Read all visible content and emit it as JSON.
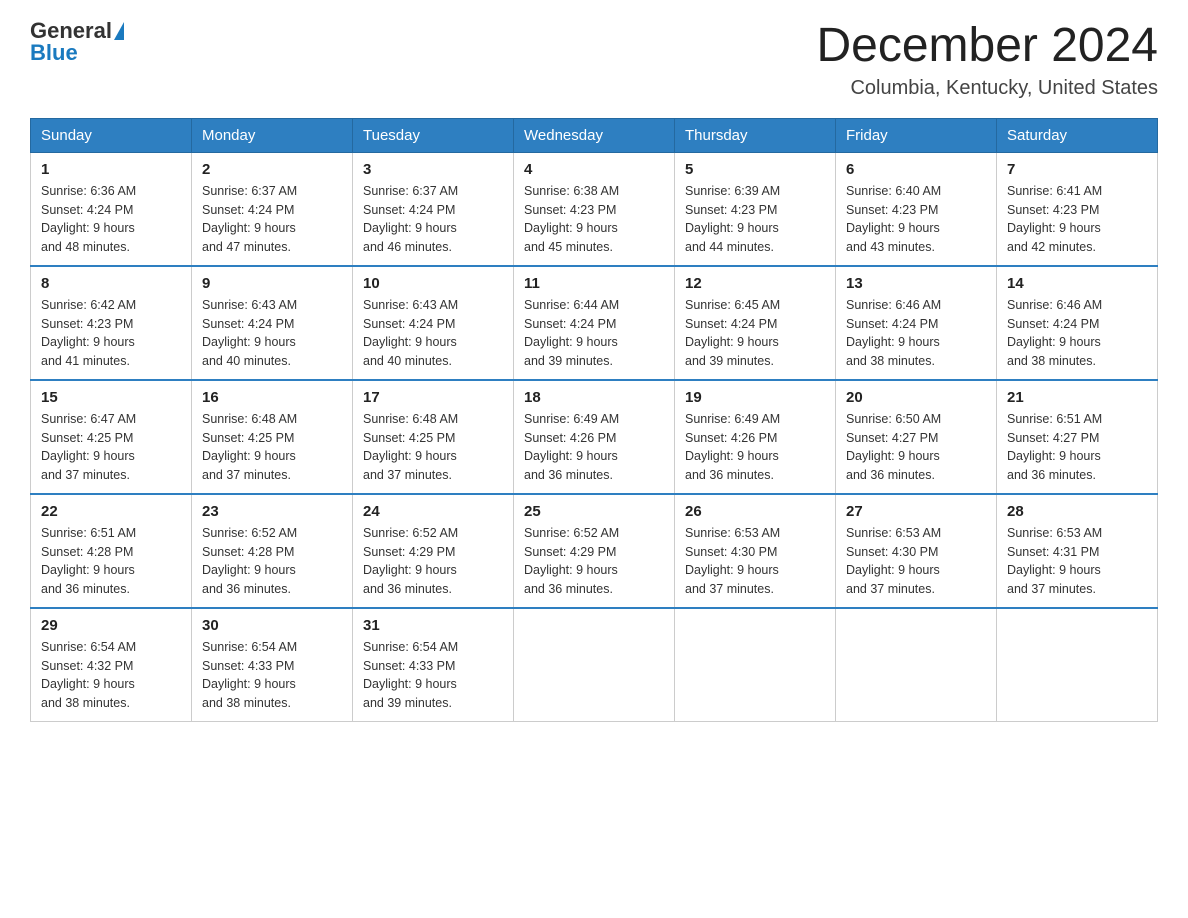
{
  "header": {
    "logo_general": "General",
    "logo_blue": "Blue",
    "month_title": "December 2024",
    "location": "Columbia, Kentucky, United States"
  },
  "days_of_week": [
    "Sunday",
    "Monday",
    "Tuesday",
    "Wednesday",
    "Thursday",
    "Friday",
    "Saturday"
  ],
  "weeks": [
    [
      {
        "day": "1",
        "sunrise": "6:36 AM",
        "sunset": "4:24 PM",
        "daylight": "9 hours and 48 minutes."
      },
      {
        "day": "2",
        "sunrise": "6:37 AM",
        "sunset": "4:24 PM",
        "daylight": "9 hours and 47 minutes."
      },
      {
        "day": "3",
        "sunrise": "6:37 AM",
        "sunset": "4:24 PM",
        "daylight": "9 hours and 46 minutes."
      },
      {
        "day": "4",
        "sunrise": "6:38 AM",
        "sunset": "4:23 PM",
        "daylight": "9 hours and 45 minutes."
      },
      {
        "day": "5",
        "sunrise": "6:39 AM",
        "sunset": "4:23 PM",
        "daylight": "9 hours and 44 minutes."
      },
      {
        "day": "6",
        "sunrise": "6:40 AM",
        "sunset": "4:23 PM",
        "daylight": "9 hours and 43 minutes."
      },
      {
        "day": "7",
        "sunrise": "6:41 AM",
        "sunset": "4:23 PM",
        "daylight": "9 hours and 42 minutes."
      }
    ],
    [
      {
        "day": "8",
        "sunrise": "6:42 AM",
        "sunset": "4:23 PM",
        "daylight": "9 hours and 41 minutes."
      },
      {
        "day": "9",
        "sunrise": "6:43 AM",
        "sunset": "4:24 PM",
        "daylight": "9 hours and 40 minutes."
      },
      {
        "day": "10",
        "sunrise": "6:43 AM",
        "sunset": "4:24 PM",
        "daylight": "9 hours and 40 minutes."
      },
      {
        "day": "11",
        "sunrise": "6:44 AM",
        "sunset": "4:24 PM",
        "daylight": "9 hours and 39 minutes."
      },
      {
        "day": "12",
        "sunrise": "6:45 AM",
        "sunset": "4:24 PM",
        "daylight": "9 hours and 39 minutes."
      },
      {
        "day": "13",
        "sunrise": "6:46 AM",
        "sunset": "4:24 PM",
        "daylight": "9 hours and 38 minutes."
      },
      {
        "day": "14",
        "sunrise": "6:46 AM",
        "sunset": "4:24 PM",
        "daylight": "9 hours and 38 minutes."
      }
    ],
    [
      {
        "day": "15",
        "sunrise": "6:47 AM",
        "sunset": "4:25 PM",
        "daylight": "9 hours and 37 minutes."
      },
      {
        "day": "16",
        "sunrise": "6:48 AM",
        "sunset": "4:25 PM",
        "daylight": "9 hours and 37 minutes."
      },
      {
        "day": "17",
        "sunrise": "6:48 AM",
        "sunset": "4:25 PM",
        "daylight": "9 hours and 37 minutes."
      },
      {
        "day": "18",
        "sunrise": "6:49 AM",
        "sunset": "4:26 PM",
        "daylight": "9 hours and 36 minutes."
      },
      {
        "day": "19",
        "sunrise": "6:49 AM",
        "sunset": "4:26 PM",
        "daylight": "9 hours and 36 minutes."
      },
      {
        "day": "20",
        "sunrise": "6:50 AM",
        "sunset": "4:27 PM",
        "daylight": "9 hours and 36 minutes."
      },
      {
        "day": "21",
        "sunrise": "6:51 AM",
        "sunset": "4:27 PM",
        "daylight": "9 hours and 36 minutes."
      }
    ],
    [
      {
        "day": "22",
        "sunrise": "6:51 AM",
        "sunset": "4:28 PM",
        "daylight": "9 hours and 36 minutes."
      },
      {
        "day": "23",
        "sunrise": "6:52 AM",
        "sunset": "4:28 PM",
        "daylight": "9 hours and 36 minutes."
      },
      {
        "day": "24",
        "sunrise": "6:52 AM",
        "sunset": "4:29 PM",
        "daylight": "9 hours and 36 minutes."
      },
      {
        "day": "25",
        "sunrise": "6:52 AM",
        "sunset": "4:29 PM",
        "daylight": "9 hours and 36 minutes."
      },
      {
        "day": "26",
        "sunrise": "6:53 AM",
        "sunset": "4:30 PM",
        "daylight": "9 hours and 37 minutes."
      },
      {
        "day": "27",
        "sunrise": "6:53 AM",
        "sunset": "4:30 PM",
        "daylight": "9 hours and 37 minutes."
      },
      {
        "day": "28",
        "sunrise": "6:53 AM",
        "sunset": "4:31 PM",
        "daylight": "9 hours and 37 minutes."
      }
    ],
    [
      {
        "day": "29",
        "sunrise": "6:54 AM",
        "sunset": "4:32 PM",
        "daylight": "9 hours and 38 minutes."
      },
      {
        "day": "30",
        "sunrise": "6:54 AM",
        "sunset": "4:33 PM",
        "daylight": "9 hours and 38 minutes."
      },
      {
        "day": "31",
        "sunrise": "6:54 AM",
        "sunset": "4:33 PM",
        "daylight": "9 hours and 39 minutes."
      },
      null,
      null,
      null,
      null
    ]
  ],
  "labels": {
    "sunrise": "Sunrise:",
    "sunset": "Sunset:",
    "daylight": "Daylight:"
  }
}
